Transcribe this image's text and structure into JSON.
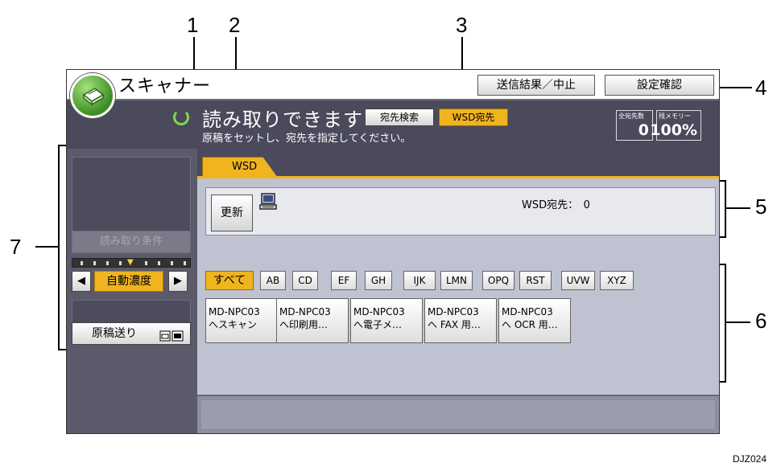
{
  "callouts": [
    "1",
    "2",
    "3",
    "4",
    "5",
    "6",
    "7"
  ],
  "app": {
    "title": "スキャナー"
  },
  "topbar": {
    "send_result_button": "送信結果／中止",
    "settings_confirm_button": "設定確認"
  },
  "status": {
    "main_text": "読み取りできます",
    "sub_text": "原稿をセットし、宛先を指定してください。",
    "dest_search_button": "宛先検索",
    "wsd_dest_button": "WSD宛先"
  },
  "counters": {
    "total_dest_label": "全宛先数",
    "total_dest_value": "0",
    "memory_label": "残メモリー",
    "memory_value": "100%"
  },
  "sidebar": {
    "read_conditions_label": "読み取り条件",
    "density_left": "◀",
    "density_label": "自動濃度",
    "density_right": "▶",
    "original_feed_label": "原稿送り"
  },
  "tabs": {
    "active": "WSD"
  },
  "wsd_panel": {
    "refresh_button": "更新",
    "dest_count_text": "WSD宛先：　0"
  },
  "filters": [
    "すべて",
    "AB",
    "CD",
    "EF",
    "GH",
    "IJK",
    "LMN",
    "OPQ",
    "RST",
    "UVW",
    "XYZ"
  ],
  "destinations": [
    {
      "line1": "MD-NPC03",
      "line2": "へスキャン"
    },
    {
      "line1": "MD-NPC03",
      "line2": "へ印刷用…"
    },
    {
      "line1": "MD-NPC03",
      "line2": "へ電子メ…"
    },
    {
      "line1": "MD-NPC03",
      "line2": "へ FAX 用…"
    },
    {
      "line1": "MD-NPC03",
      "line2": "へ OCR 用…"
    }
  ],
  "footnote": "DJZ024",
  "colors": {
    "accent": "#f0b41e",
    "header": "#4a4a5c",
    "panel": "#bfc2d0"
  }
}
